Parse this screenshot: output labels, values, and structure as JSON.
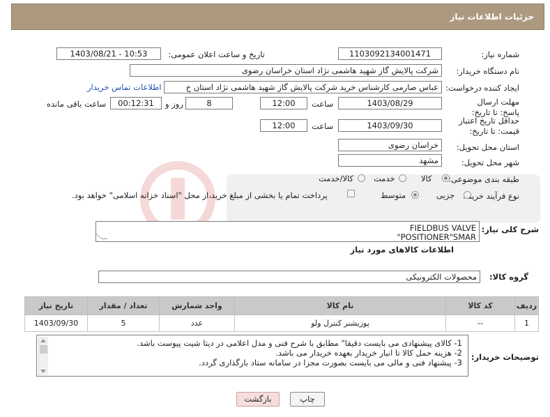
{
  "header": {
    "title": "جزئیات اطلاعات نیاز"
  },
  "labels": {
    "need_number": "شماره نیاز:",
    "announce_datetime": "تاریخ و ساعت اعلان عمومی:",
    "buyer_org": "نام دستگاه خریدار:",
    "requester": "ایجاد کننده درخواست:",
    "send_deadline": "مهلت ارسال پاسخ: تا تاریخ:",
    "price_validity": "حداقل تاریخ اعتبار قیمت: تا تاریخ:",
    "time": "ساعت",
    "days_and": "روز و",
    "hours_remaining": "ساعت باقی مانده",
    "delivery_province": "استان محل تحویل:",
    "delivery_city": "شهر محل تحویل:",
    "subject_category": "طبقه بندی موضوعی:",
    "purchase_process": "نوع فرآیند خرید :",
    "general_description": "شرح کلی نیاز:",
    "goods_info": "اطلاعات کالاهای مورد نیاز",
    "goods_group": "گروه کالا:",
    "buyer_notes": "توضیحات خریدار:"
  },
  "values": {
    "need_number": "1103092134001471",
    "announce_datetime": "1403/08/21 - 10:53",
    "buyer_org": "شرکت پالایش گاز شهید هاشمی نژاد   استان خراسان رضوی",
    "requester": "عباس صارمی کارشناس خرید  شرکت پالایش گاز شهید هاشمی نژاد   استان خ",
    "send_date": "1403/08/29",
    "send_time": "12:00",
    "days": "8",
    "remaining": "00:12:31",
    "price_date": "1403/09/30",
    "price_time": "12:00",
    "delivery_province": "خراسان رضوی",
    "delivery_city": "مشهد",
    "goods_group": "محصولات الکترونیکی"
  },
  "links": {
    "buyer_contact": "اطلاعات تماس خریدار"
  },
  "category_options": {
    "goods": "کالا",
    "service": "خدمت",
    "goods_service": "کالا/خدمت"
  },
  "process_options": {
    "minor": "جزیی",
    "medium": "متوسط"
  },
  "payment_note": "پرداخت تمام یا بخشی از مبلغ خرید،از محل \"اسناد خزانه اسلامی\" خواهد بود.",
  "description_lines": [
    "FIELDBUS VALVE",
    "\"POSITIONER\"SMAR"
  ],
  "table": {
    "headers": [
      "ردیف",
      "کد کالا",
      "نام کالا",
      "واحد شمارش",
      "تعداد / مقدار",
      "تاریخ نیاز"
    ],
    "rows": [
      [
        "1",
        "--",
        "پوزیشنر کنترل ولو",
        "عدد",
        "5",
        "1403/09/30"
      ]
    ]
  },
  "notes": [
    "1-    کالای پیشنهادی می بایست دقیقا\" مطابق با شرح فنی و مدل اعلامی در دیتا شیت پیوست باشد.",
    "2-    هزینه حمل کالا تا انبار خریدار بعهده خریدار می باشد.",
    "3-    پیشنهاد فنی و مالی می بایست بصورت مجزا در سامانه ستاد بارگذاری گردد."
  ],
  "buttons": {
    "print": "چاپ",
    "back": "بازگشت"
  },
  "colors": {
    "header_bg": "#ad9980",
    "link": "#1f4fb3",
    "back_button_bg": "#f7dede"
  }
}
